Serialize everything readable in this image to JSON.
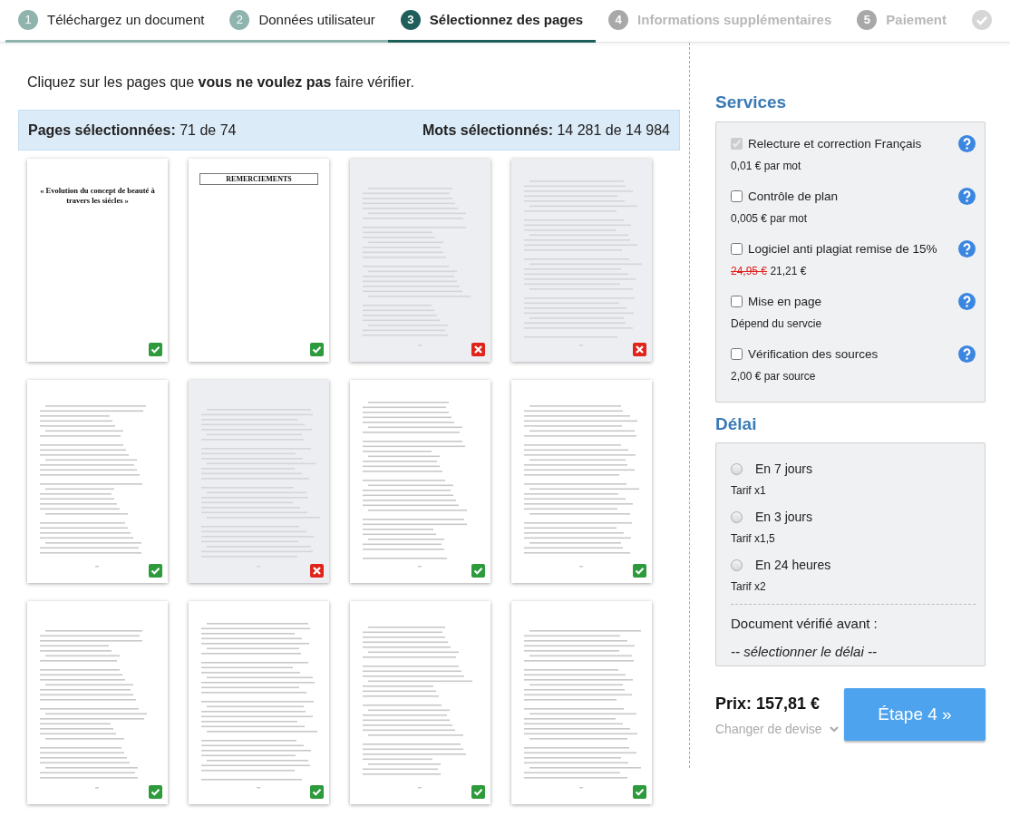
{
  "steps": [
    {
      "number": "1",
      "label": "Téléchargez un document",
      "kind": "done"
    },
    {
      "number": "2",
      "label": "Données utilisateur",
      "kind": "done"
    },
    {
      "number": "3",
      "label": "Sélectionnez des pages",
      "kind": "active"
    },
    {
      "number": "4",
      "label": "Informations supplémentaires",
      "kind": "disabled"
    },
    {
      "number": "5",
      "label": "Paiement",
      "kind": "disabled"
    },
    {
      "kind": "finish"
    }
  ],
  "instruction": "Cliquez sur les pages que **vous ne voulez pas** faire vérifier.",
  "summary": {
    "pages_label": "Pages sélectionnées:",
    "pages_value": "71 de 74",
    "words_label": "Mots sélectionnés:",
    "words_value": "14 281 de 14 984"
  },
  "pages": [
    {
      "selected": true,
      "title": "« Evolution du concept de beauté à travers les siécles »"
    },
    {
      "selected": true,
      "heading": "REMERCIEMENTS"
    },
    {
      "selected": false
    },
    {
      "selected": false
    },
    {
      "selected": true
    },
    {
      "selected": false
    },
    {
      "selected": true
    },
    {
      "selected": true
    },
    {
      "selected": true
    },
    {
      "selected": true
    },
    {
      "selected": true
    },
    {
      "selected": true
    }
  ],
  "services": {
    "title": "Services",
    "items": [
      {
        "label": "Relecture et correction Français",
        "checked": true,
        "disabled": true,
        "price": "0,01 € par mot"
      },
      {
        "label": "Contrôle de plan",
        "checked": false,
        "disabled": false,
        "price": "0,005 € par mot"
      },
      {
        "label": "Logiciel anti plagiat remise de 15%",
        "checked": false,
        "disabled": false,
        "old_price": "24,95 €",
        "price": "21,21 €"
      },
      {
        "label": "Mise en page",
        "checked": false,
        "disabled": false,
        "price": "Dépend du servcie"
      },
      {
        "label": "Vérification des sources",
        "checked": false,
        "disabled": false,
        "price": "2,00 € par source"
      }
    ]
  },
  "delay": {
    "title": "Délai",
    "options": [
      {
        "label": "En 7 jours",
        "selected": false,
        "rate": "Tarif x1"
      },
      {
        "label": "En 3 jours",
        "selected": false,
        "rate": "Tarif x1,5"
      },
      {
        "label": "En 24 heures",
        "selected": false,
        "rate": "Tarif x2"
      }
    ],
    "deadline_label": "Document vérifié avant :",
    "deadline_value": "-- sélectionner le délai --"
  },
  "price": "Prix: 157,81 €",
  "currency_link": "Changer de devise",
  "next_button": "Étape 4 »"
}
